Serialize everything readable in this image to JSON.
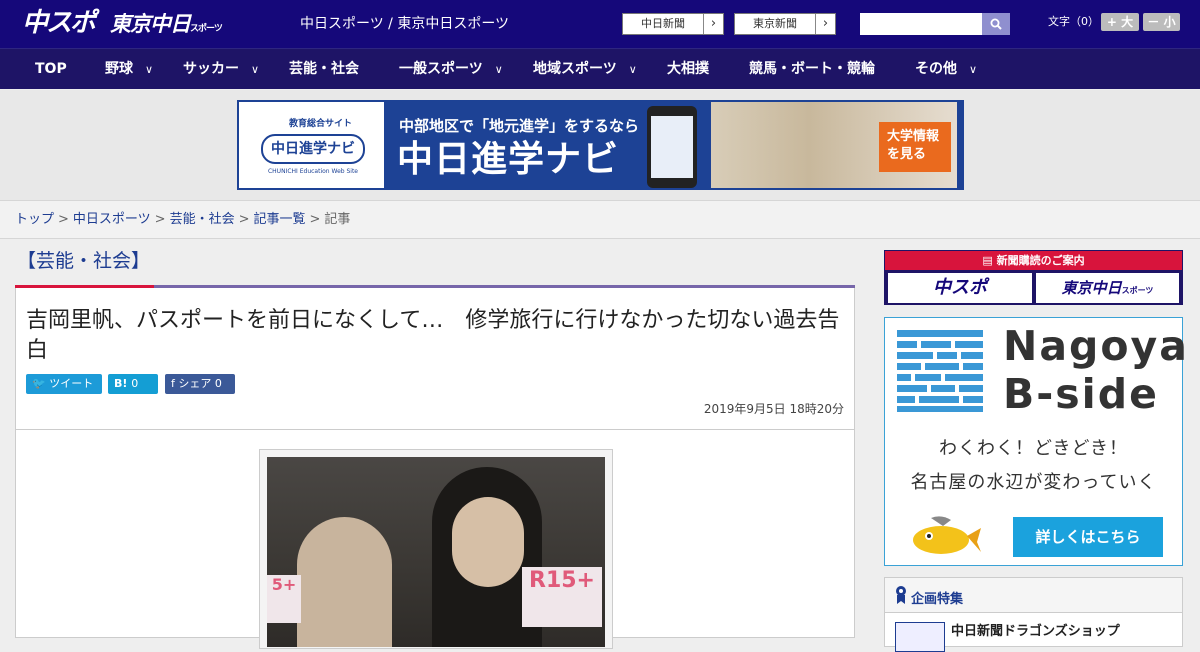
{
  "header": {
    "logo_main": "中スポ",
    "logo_tokyo": "東京中日",
    "logo_tokyo_small": "スポーツ",
    "subtitle": "中日スポーツ / 東京中日スポーツ",
    "paper_links": [
      "中日新聞",
      "東京新聞"
    ],
    "search": {
      "placeholder": "",
      "button_icon": "search-icon"
    },
    "font_size": {
      "label": "文字（0）",
      "larger": "+ 大",
      "smaller": "－ 小"
    }
  },
  "nav": {
    "items": [
      {
        "label": "TOP",
        "dropdown": false
      },
      {
        "label": "野球",
        "dropdown": true
      },
      {
        "label": "サッカー",
        "dropdown": true
      },
      {
        "label": "芸能・社会",
        "dropdown": false
      },
      {
        "label": "一般スポーツ",
        "dropdown": true
      },
      {
        "label": "地域スポーツ",
        "dropdown": true
      },
      {
        "label": "大相撲",
        "dropdown": false
      },
      {
        "label": "競馬・ボート・競輪",
        "dropdown": false
      },
      {
        "label": "その他",
        "dropdown": true
      }
    ]
  },
  "banner": {
    "edu_label": "教育総合サイト",
    "badge": "中日進学ナビ",
    "web_site": "CHUNICHI Education Web Site",
    "tagline": "中部地区で「地元進学」をするなら",
    "title": "中日進学ナビ",
    "cta": "大学情報を見る"
  },
  "breadcrumb": [
    "トップ",
    "中日スポーツ",
    "芸能・社会",
    "記事一覧",
    "記事"
  ],
  "article": {
    "category": "【芸能・社会】",
    "headline": "吉岡里帆、パスポートを前日になくして…　修学旅行に行けなかった切ない過去告白",
    "share": {
      "tweet": "ツイート",
      "hatena": "B!",
      "hatena_count": "0",
      "facebook": "シェア",
      "facebook_count": "0"
    },
    "date": "2019年9月5日 18時20分",
    "photo_sign_text": "R15+"
  },
  "sidebar": {
    "subscribe": {
      "heading": "新聞購読のご案内",
      "buttons": [
        "中スポ",
        "東京中日"
      ],
      "button_small": "スポーツ"
    },
    "bside": {
      "name_line1": "Nagoya",
      "name_line2": "B-side",
      "line1": "わくわく！どきどき！",
      "line2": "名古屋の水辺が変わっていく",
      "cta": "詳しくはこちら"
    },
    "feature": {
      "title": "企画特集",
      "item": "中日新聞ドラゴンズショップ"
    }
  },
  "colors": {
    "header_bg": "#15087a",
    "nav_bg": "#1e1466",
    "accent_red": "#d8143c",
    "link": "#1d3c91",
    "bside_blue": "#1ba2dd"
  }
}
